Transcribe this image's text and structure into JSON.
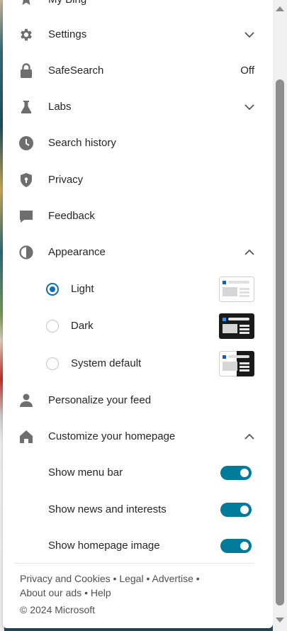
{
  "menu": {
    "top_partial_label": "My Bing",
    "items": [
      {
        "label": "Settings",
        "icon": "gear-icon",
        "trailing": "chevron-down"
      },
      {
        "label": "SafeSearch",
        "icon": "lock-icon",
        "value": "Off"
      },
      {
        "label": "Labs",
        "icon": "flask-icon",
        "trailing": "chevron-down"
      },
      {
        "label": "Search history",
        "icon": "clock-icon"
      },
      {
        "label": "Privacy",
        "icon": "shield-icon"
      },
      {
        "label": "Feedback",
        "icon": "feedback-icon"
      },
      {
        "label": "Appearance",
        "icon": "contrast-icon",
        "trailing": "chevron-up"
      },
      {
        "label": "Personalize your feed",
        "icon": "person-icon"
      },
      {
        "label": "Customize your homepage",
        "icon": "home-icon",
        "trailing": "chevron-up"
      }
    ]
  },
  "appearance": {
    "options": [
      {
        "label": "Light",
        "selected": true
      },
      {
        "label": "Dark",
        "selected": false
      },
      {
        "label": "System default",
        "selected": false
      }
    ]
  },
  "homepage": {
    "toggles": [
      {
        "label": "Show menu bar",
        "on": true
      },
      {
        "label": "Show news and interests",
        "on": true
      },
      {
        "label": "Show homepage image",
        "on": true
      }
    ]
  },
  "footer": {
    "privacy": "Privacy and Cookies",
    "legal": "Legal",
    "advertise": "Advertise",
    "about_ads": "About our ads",
    "help": "Help",
    "sep": "•",
    "copyright": "© 2024 Microsoft"
  },
  "colors": {
    "accent": "#0f6cbd",
    "toggle_on": "#007b9a",
    "icon": "#6e6e6e"
  }
}
